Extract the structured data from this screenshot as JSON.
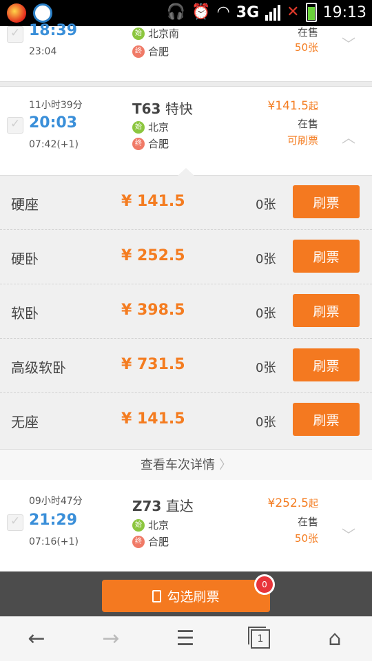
{
  "status_bar": {
    "network": "3G",
    "time": "19:13",
    "icons": [
      "app-icon",
      "app-icon",
      "headphones-icon",
      "alarm-icon",
      "wifi-icon",
      "signal-icon",
      "no-signal-icon",
      "battery-icon"
    ]
  },
  "trains": [
    {
      "duration": "",
      "depart": "18:39",
      "arrive": "23:04",
      "name": "",
      "from": "北京南",
      "to": "合肥",
      "price": "",
      "status": "在售",
      "availability": "50张",
      "expanded": false
    },
    {
      "duration": "11小时39分",
      "depart": "20:03",
      "arrive": "07:42(+1)",
      "name_code": "T63",
      "name_type": "特快",
      "from": "北京",
      "to": "合肥",
      "price": "¥141.5",
      "price_suffix": "起",
      "status": "在售",
      "availability": "可刷票",
      "expanded": true
    },
    {
      "duration": "09小时47分",
      "depart": "21:29",
      "arrive": "07:16(+1)",
      "name_code": "Z73",
      "name_type": "直达",
      "from": "北京",
      "to": "合肥",
      "price": "¥252.5",
      "price_suffix": "起",
      "status": "在售",
      "availability": "50张",
      "expanded": false
    }
  ],
  "station_badges": {
    "start": "始",
    "end": "终"
  },
  "seats": [
    {
      "type": "硬座",
      "price": "¥ 141.5",
      "count": "0张",
      "button": "刷票"
    },
    {
      "type": "硬卧",
      "price": "¥ 252.5",
      "count": "0张",
      "button": "刷票"
    },
    {
      "type": "软卧",
      "price": "¥ 398.5",
      "count": "0张",
      "button": "刷票"
    },
    {
      "type": "高级软卧",
      "price": "¥ 731.5",
      "count": "0张",
      "button": "刷票"
    },
    {
      "type": "无座",
      "price": "¥ 141.5",
      "count": "0张",
      "button": "刷票"
    }
  ],
  "details_link": "查看车次详情",
  "action": {
    "label": "勾选刷票",
    "count": "0"
  },
  "colors": {
    "accent": "#f47920",
    "time_blue": "#3a8fd9",
    "start_green": "#8cc63f",
    "end_red": "#f07a67",
    "badge_red": "#e8353b"
  },
  "nav_icons": [
    "back-arrow-icon",
    "forward-arrow-icon",
    "menu-icon",
    "tabs-icon",
    "home-icon"
  ],
  "tabs_count": "1"
}
